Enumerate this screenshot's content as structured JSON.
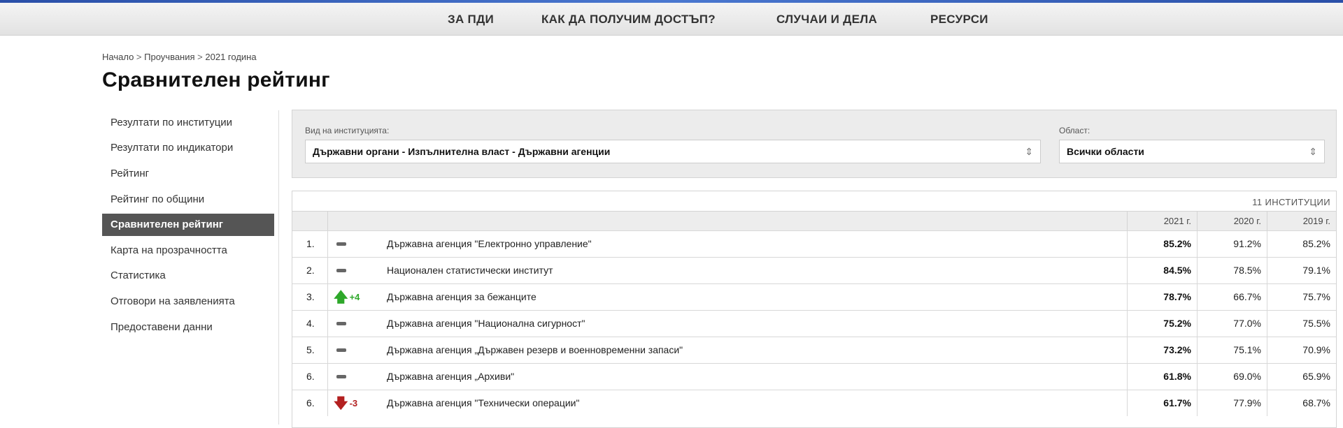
{
  "nav": {
    "items": [
      {
        "label": "ЗА ПДИ"
      },
      {
        "label": "КАК ДА ПОЛУЧИМ ДОСТЪП?"
      },
      {
        "label": "СЛУЧАИ И ДЕЛА"
      },
      {
        "label": "РЕСУРСИ"
      }
    ]
  },
  "breadcrumb": {
    "items": [
      "Начало",
      "Проучвания",
      "2021 година"
    ],
    "separator": ">"
  },
  "page": {
    "title": "Сравнителен рейтинг"
  },
  "sidebar": {
    "items": [
      {
        "label": "Резултати по институции"
      },
      {
        "label": "Резултати по индикатори"
      },
      {
        "label": "Рейтинг"
      },
      {
        "label": "Рейтинг по общини"
      },
      {
        "label": "Сравнителен рейтинг",
        "active": true
      },
      {
        "label": "Карта на прозрачността"
      },
      {
        "label": "Статистика"
      },
      {
        "label": "Отговори на заявленията"
      },
      {
        "label": "Предоставени данни"
      }
    ]
  },
  "filters": {
    "institution_type": {
      "label": "Вид на институцията:",
      "value": "Държавни органи - Изпълнителна власт - Държавни агенции"
    },
    "region": {
      "label": "Област:",
      "value": "Всички области"
    },
    "chevron_icon": "sort-chevrons-icon"
  },
  "table": {
    "count_label": "11 ИНСТИТУЦИИ",
    "columns": [
      "2021 г.",
      "2020 г.",
      "2019 г."
    ],
    "colors": {
      "up": "#2ea82a",
      "down": "#b32020",
      "header_bg": "#ededed",
      "active_sidebar": "#555555"
    },
    "rows": [
      {
        "rank": "1.",
        "trend": "same",
        "change": "",
        "name": "Държавна агенция \"Електронно управление\"",
        "v2021": "85.2%",
        "v2020": "91.2%",
        "v2019": "85.2%"
      },
      {
        "rank": "2.",
        "trend": "same",
        "change": "",
        "name": "Национален статистически институт",
        "v2021": "84.5%",
        "v2020": "78.5%",
        "v2019": "79.1%"
      },
      {
        "rank": "3.",
        "trend": "up",
        "change": "+4",
        "name": "Държавна агенция за бежанците",
        "v2021": "78.7%",
        "v2020": "66.7%",
        "v2019": "75.7%"
      },
      {
        "rank": "4.",
        "trend": "same",
        "change": "",
        "name": "Държавна агенция \"Национална сигурност\"",
        "v2021": "75.2%",
        "v2020": "77.0%",
        "v2019": "75.5%"
      },
      {
        "rank": "5.",
        "trend": "same",
        "change": "",
        "name": "Държавна агенция „Държавен резерв и военновременни запаси\"",
        "v2021": "73.2%",
        "v2020": "75.1%",
        "v2019": "70.9%"
      },
      {
        "rank": "6.",
        "trend": "same",
        "change": "",
        "name": "Държавна агенция „Архиви\"",
        "v2021": "61.8%",
        "v2020": "69.0%",
        "v2019": "65.9%"
      },
      {
        "rank": "6.",
        "trend": "down",
        "change": "-3",
        "name": "Държавна агенция \"Технически операции\"",
        "v2021": "61.7%",
        "v2020": "77.9%",
        "v2019": "68.7%"
      }
    ]
  }
}
